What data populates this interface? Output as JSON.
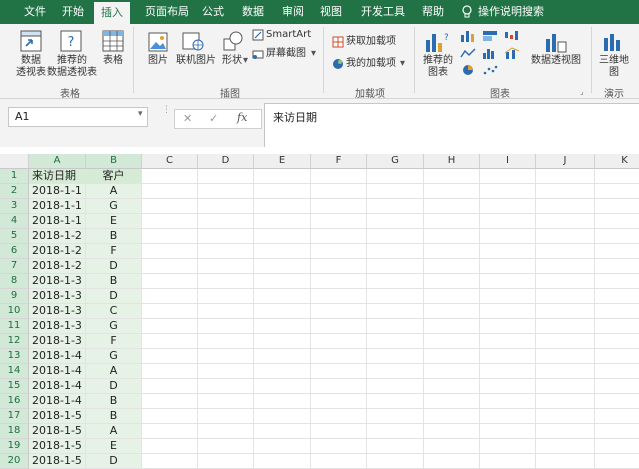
{
  "ribbon_tabs": [
    "文件",
    "开始",
    "插入",
    "页面布局",
    "公式",
    "数据",
    "审阅",
    "视图",
    "开发工具",
    "帮助",
    "操作说明搜索"
  ],
  "active_tab": "插入",
  "ribbon": {
    "pivot_table": "数据\n透视表",
    "recommended_pivot": "推荐的\n数据透视表",
    "table": "表格",
    "picture": "图片",
    "online_picture": "联机图片",
    "shapes": "形状",
    "smartart": "SmartArt",
    "screenshot": "屏幕截图",
    "get_addins": "获取加载项",
    "my_addins": "我的加载项",
    "recommended_charts": "推荐的\n图表",
    "pivot_chart": "数据透视图",
    "map_3d": "三维地\n图",
    "groups": {
      "tables": "表格",
      "illustrations": "插图",
      "addins": "加载项",
      "charts": "图表",
      "tours": "演示"
    }
  },
  "formula_bar": {
    "name_box": "A1",
    "formula": "来访日期"
  },
  "columns": [
    "A",
    "B",
    "C",
    "D",
    "E",
    "F",
    "G",
    "H",
    "I",
    "J",
    "K"
  ],
  "rows": [
    {
      "n": "1",
      "a": "来访日期",
      "b": "客户"
    },
    {
      "n": "2",
      "a": "2018-1-1",
      "b": "A"
    },
    {
      "n": "3",
      "a": "2018-1-1",
      "b": "G"
    },
    {
      "n": "4",
      "a": "2018-1-1",
      "b": "E"
    },
    {
      "n": "5",
      "a": "2018-1-2",
      "b": "B"
    },
    {
      "n": "6",
      "a": "2018-1-2",
      "b": "F"
    },
    {
      "n": "7",
      "a": "2018-1-2",
      "b": "D"
    },
    {
      "n": "8",
      "a": "2018-1-3",
      "b": "B"
    },
    {
      "n": "9",
      "a": "2018-1-3",
      "b": "D"
    },
    {
      "n": "10",
      "a": "2018-1-3",
      "b": "C"
    },
    {
      "n": "11",
      "a": "2018-1-3",
      "b": "G"
    },
    {
      "n": "12",
      "a": "2018-1-3",
      "b": "F"
    },
    {
      "n": "13",
      "a": "2018-1-4",
      "b": "G"
    },
    {
      "n": "14",
      "a": "2018-1-4",
      "b": "A"
    },
    {
      "n": "15",
      "a": "2018-1-4",
      "b": "D"
    },
    {
      "n": "16",
      "a": "2018-1-4",
      "b": "B"
    },
    {
      "n": "17",
      "a": "2018-1-5",
      "b": "B"
    },
    {
      "n": "18",
      "a": "2018-1-5",
      "b": "A"
    },
    {
      "n": "19",
      "a": "2018-1-5",
      "b": "E"
    },
    {
      "n": "20",
      "a": "2018-1-5",
      "b": "D"
    }
  ],
  "colors": {
    "ribbon_green": "#217346",
    "selection_fill": "#e6f2e6",
    "header_selected": "#d3e9d8"
  }
}
